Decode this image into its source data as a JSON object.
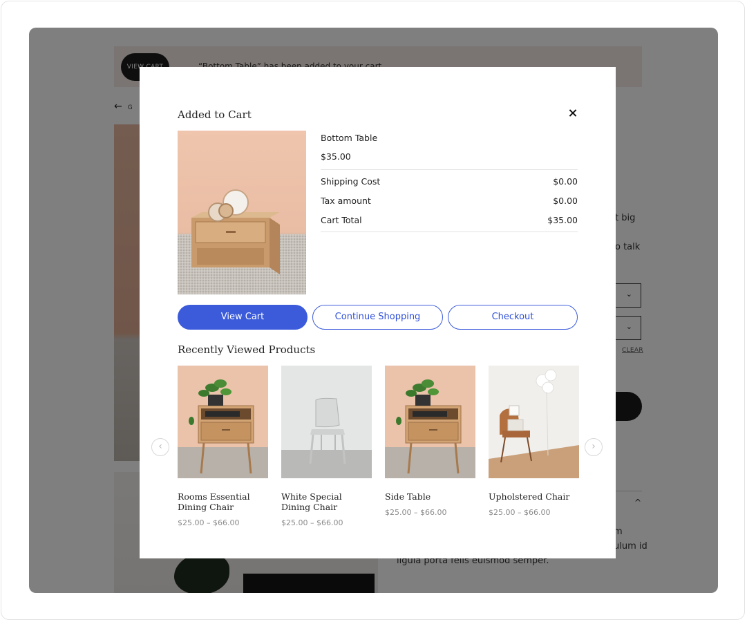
{
  "background": {
    "notice_button": "VIEW CART",
    "notice_text": "“Bottom Table” has been added to your cart.",
    "back_label": "G",
    "desc_fragment_1": "t big",
    "desc_fragment_2": "o talk",
    "clear_label": "CLEAR",
    "bottom_text_1": "m",
    "bottom_text_2": "ulum id",
    "bottom_text_3": "ligula porta felis euismod semper."
  },
  "modal": {
    "title": "Added to Cart",
    "product": {
      "name": "Bottom Table",
      "price": "$35.00"
    },
    "summary": [
      {
        "label": "Shipping Cost",
        "value": "$0.00"
      },
      {
        "label": "Tax amount",
        "value": "$0.00"
      },
      {
        "label": "Cart Total",
        "value": "$35.00"
      }
    ],
    "buttons": {
      "view_cart": "View Cart",
      "continue_shopping": "Continue Shopping",
      "checkout": "Checkout"
    },
    "recent_title": "Recently Viewed Products",
    "recent": [
      {
        "name": "Rooms Essential Dining Chair",
        "price": "$25.00 – $66.00"
      },
      {
        "name": "White Special Dining Chair",
        "price": "$25.00 – $66.00"
      },
      {
        "name": "Side Table",
        "price": "$25.00 – $66.00"
      },
      {
        "name": "Upholstered Chair",
        "price": "$25.00 – $66.00"
      }
    ]
  },
  "colors": {
    "accent": "#3b5bdb",
    "overlay": "rgba(0,0,0,0.5)"
  },
  "icons": {
    "close": "close-icon",
    "prev": "chevron-left-icon",
    "next": "chevron-right-icon",
    "back": "arrow-left-icon",
    "dropdown": "chevron-down-icon"
  }
}
